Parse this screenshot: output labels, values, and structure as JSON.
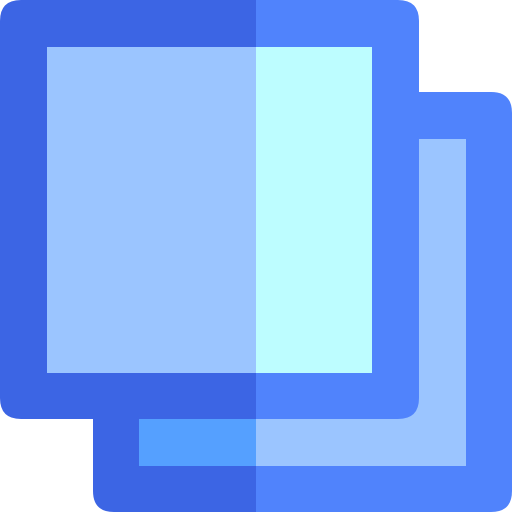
{
  "icon": {
    "name": "copy-icon",
    "description_label": "",
    "colors": {
      "frame_dark": "#3C65E4",
      "frame_light": "#5083FC",
      "fill_left": "#9BC5FF",
      "fill_right": "#BDFDFF",
      "back_fill_left": "#55A0FF",
      "back_fill_right": "#9BC5FF"
    }
  }
}
